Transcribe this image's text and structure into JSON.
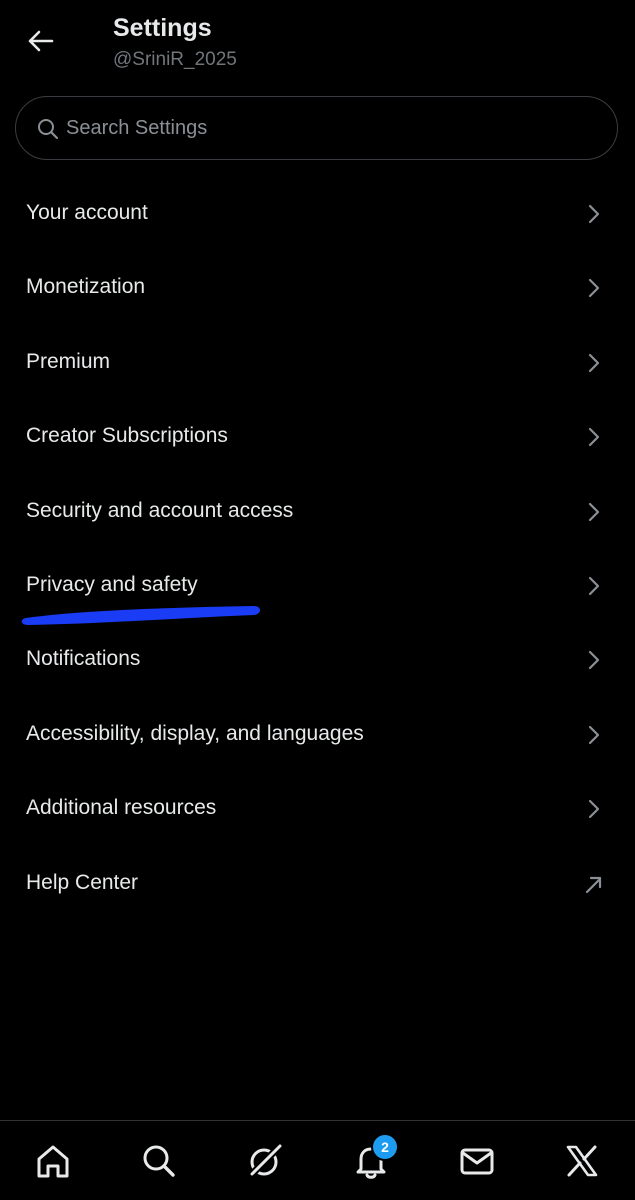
{
  "header": {
    "title": "Settings",
    "handle": "@SriniR_2025"
  },
  "search": {
    "placeholder": "Search Settings"
  },
  "menu": {
    "items": [
      {
        "label": "Your account",
        "icon": "chevron-right-icon"
      },
      {
        "label": "Monetization",
        "icon": "chevron-right-icon"
      },
      {
        "label": "Premium",
        "icon": "chevron-right-icon"
      },
      {
        "label": "Creator Subscriptions",
        "icon": "chevron-right-icon"
      },
      {
        "label": "Security and account access",
        "icon": "chevron-right-icon"
      },
      {
        "label": "Privacy and safety",
        "icon": "chevron-right-icon"
      },
      {
        "label": "Notifications",
        "icon": "chevron-right-icon"
      },
      {
        "label": "Accessibility, display, and languages",
        "icon": "chevron-right-icon"
      },
      {
        "label": "Additional resources",
        "icon": "chevron-right-icon"
      },
      {
        "label": "Help Center",
        "icon": "external-link-arrow-icon"
      }
    ]
  },
  "annotation": {
    "highlight_color": "#1a3cf5"
  },
  "tabbar": {
    "tabs": [
      "home-icon",
      "search-icon",
      "grok-icon",
      "notifications-icon",
      "messages-icon",
      "x-logo-icon"
    ],
    "notification_count": "2",
    "badge_color": "#1d9bf0"
  }
}
